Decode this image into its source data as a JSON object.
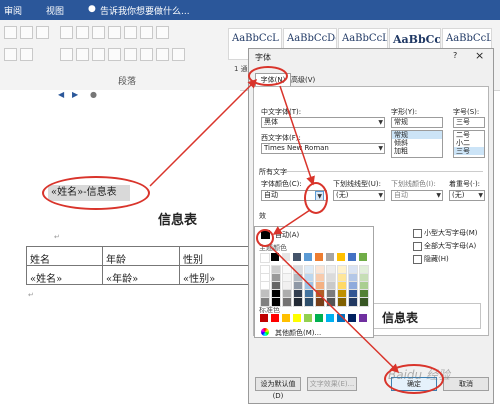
{
  "ribbon": {
    "tabs": [
      "审阅",
      "视图"
    ],
    "tell_me": "告诉我你想要做什么...",
    "group_paragraph": "段落",
    "styles": [
      "AaBbCcL",
      "AaBbCcDc",
      "AaBbCcL",
      "AaBbCcl",
      "AaBbCcL"
    ],
    "style_caption": "1 通"
  },
  "document": {
    "field_line": "«姓名»-信息表",
    "heading": "信息表",
    "table": {
      "headers": [
        "姓名",
        "年龄",
        "性别"
      ],
      "merge_fields": [
        "«姓名»",
        "«年龄»",
        "«性别»"
      ]
    }
  },
  "dialog": {
    "title": "字体",
    "help": "?",
    "close": "×",
    "tabs": [
      "字体(N)",
      "高级(V)"
    ],
    "cn_font_label": "中文字体(T):",
    "cn_font_value": "黑体",
    "west_font_label": "西文字体(F):",
    "west_font_value": "Times New Roman",
    "style_label": "字形(Y):",
    "style_value": "常规",
    "style_options": [
      "常规",
      "倾斜",
      "加粗"
    ],
    "size_label": "字号(S):",
    "size_value": "三号",
    "size_options": [
      "二号",
      "小二",
      "三号"
    ],
    "all_text_label": "所有文字",
    "font_color_label": "字体颜色(C):",
    "font_color_value": "自动",
    "underline_label": "下划线线型(U):",
    "underline_value": "(无)",
    "underline_color_label": "下划线颜色(I):",
    "underline_color_value": "自动",
    "emphasis_label": "着重号(·):",
    "emphasis_value": "(无)",
    "effects_label": "效",
    "effects": [
      "小型大写字母(M)",
      "全部大写字母(A)",
      "隐藏(H)"
    ],
    "preview_label": "预",
    "preview_text": "信息表",
    "set_default": "设为默认值(D)",
    "text_effects": "文字效果(E)...",
    "ok": "确定",
    "cancel": "取消"
  },
  "palette": {
    "auto_label": "自动(A)",
    "theme_label": "主题颜色",
    "standard_label": "标准色",
    "more_label": "其他颜色(M)...",
    "theme_top": [
      "#ffffff",
      "#000000",
      "#e7e6e6",
      "#44546a",
      "#5b9bd5",
      "#ed7d31",
      "#a5a5a5",
      "#ffc000",
      "#4472c4",
      "#70ad47"
    ],
    "standard": [
      "#c00000",
      "#ff0000",
      "#ffc000",
      "#ffff00",
      "#92d050",
      "#00b050",
      "#00b0f0",
      "#0070c0",
      "#002060",
      "#7030a0"
    ]
  },
  "watermark": "Baidu 经验",
  "accent_color": "#d9342b"
}
